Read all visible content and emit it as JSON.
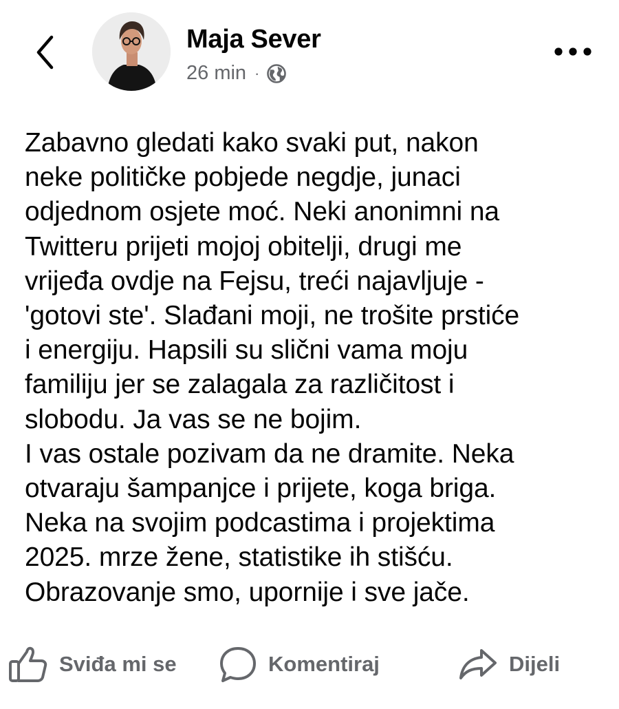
{
  "post": {
    "author": "Maja Sever",
    "time": "26 min",
    "separator": "·",
    "audience_icon": "globe-icon",
    "lines": [
      "Zabavno gledati kako svaki put, nakon",
      "neke političke pobjede negdje, junaci",
      "odjednom osjete moć. Neki anonimni na",
      "Twitteru prijeti mojoj obitelji, drugi me",
      "vrijeđa ovdje na Fejsu, treći najavljuje -",
      "'gotovi ste'. Slađani moji, ne trošite prstiće",
      "i energiju. Hapsili su slični vama moju",
      "familiju jer se zalagala za različitost i",
      "slobodu. Ja vas se ne bojim.",
      "I vas ostale pozivam da ne dramite. Neka",
      "otvaraju šampanjce i prijete, koga briga.",
      "Neka na svojim podcastima i projektima",
      "2025. mrze žene, statistike ih stišću.",
      "Obrazovanje smo, upornije i sve jače."
    ]
  },
  "actions": {
    "like": "Sviđa mi se",
    "comment": "Komentiraj",
    "share": "Dijeli"
  },
  "colors": {
    "text": "#050505",
    "secondary": "#65676b",
    "background": "#ffffff"
  }
}
